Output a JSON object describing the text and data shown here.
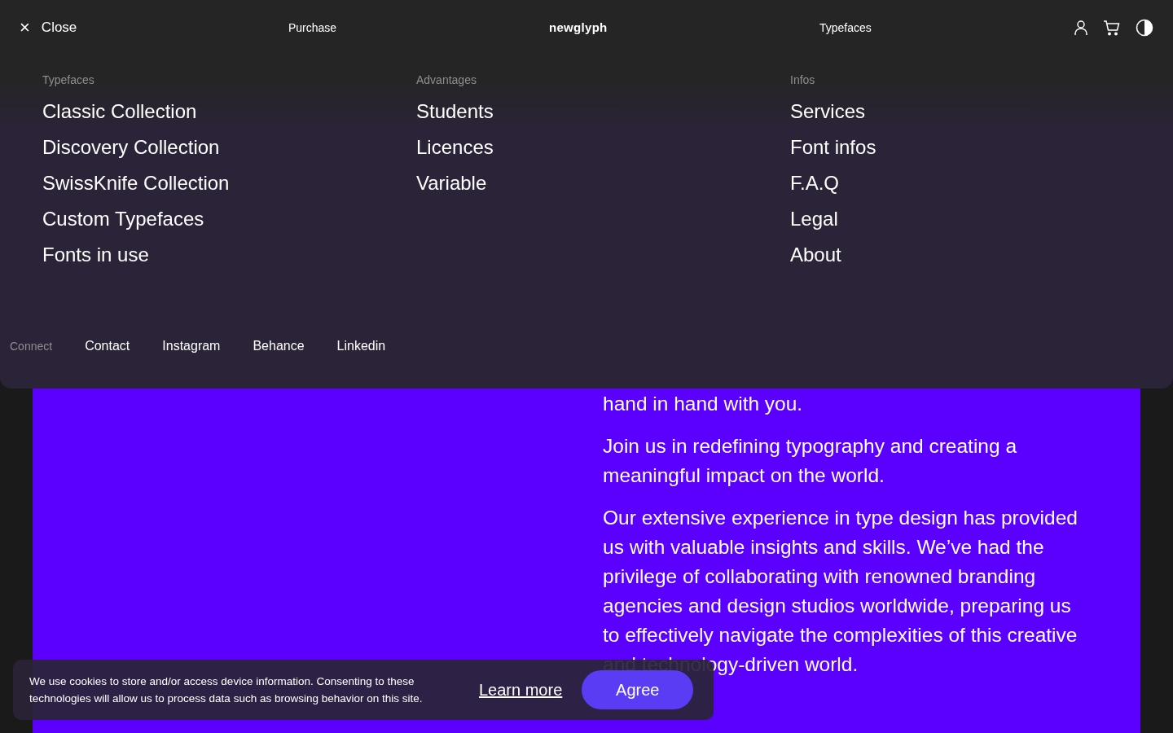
{
  "header": {
    "close": {
      "icon": "×",
      "label": "Close"
    },
    "links": [
      "Purchase",
      "Typefaces"
    ],
    "logo": "newglyph"
  },
  "menu": {
    "columns": [
      {
        "heading": "Typefaces",
        "items": [
          "Classic Collection",
          "Discovery Collection",
          "SwissKnife Collection",
          "Custom Typefaces",
          "Fonts in use"
        ]
      },
      {
        "heading": "Advantages",
        "items": [
          "Students",
          "Licences",
          "Variable"
        ]
      },
      {
        "heading": "Infos",
        "items": [
          "Services",
          "Font infos",
          "F.A.Q",
          "Legal",
          "About"
        ]
      }
    ],
    "connect": {
      "label": "Connect",
      "links": [
        "Contact",
        "Instagram",
        "Behance",
        "Linkedin"
      ]
    }
  },
  "content": {
    "paragraphs": [
      "hand in hand with you.",
      "Join us in redefining typography and creating a meaningful impact on the world.",
      "Our extensive experience in type design has provided us with valuable insights and skills. We’ve had the privilege of collaborating with renowned branding agencies and design studios worldwide, preparing us to effectively navigate the complexities of this creative and technology-driven world."
    ]
  },
  "cookie": {
    "text": "We use cookies to store and/or access device information. Consenting to these technologies will allow us to process data such as browsing behavior on this site.",
    "learn_more": "Learn more",
    "agree": "Agree"
  }
}
